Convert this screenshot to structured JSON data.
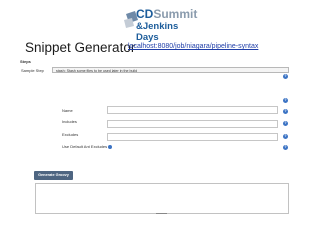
{
  "logo": {
    "line1_cd": "CD",
    "line1_summit": "Summit",
    "line2": "&Jenkins Days"
  },
  "heading": "Snippet Generator",
  "url": "localhost:8080/job/niagara/pipeline-syntax",
  "form": {
    "steps_label": "Steps",
    "sample_step_label": "Sample Step",
    "sample_step_value": "stash: Stash some files to be used later in the build",
    "fields": [
      {
        "label": "Name"
      },
      {
        "label": "Includes"
      },
      {
        "label": "Excludes"
      }
    ],
    "default_excludes_label": "Use Default Ant Excludes",
    "generate_button": "Generate Groovy",
    "help_glyph": "?"
  },
  "colors": {
    "brand_blue": "#1d5d9b",
    "link": "#1f3ea8",
    "help_icon": "#3b73c4",
    "button": "#4e6581"
  }
}
